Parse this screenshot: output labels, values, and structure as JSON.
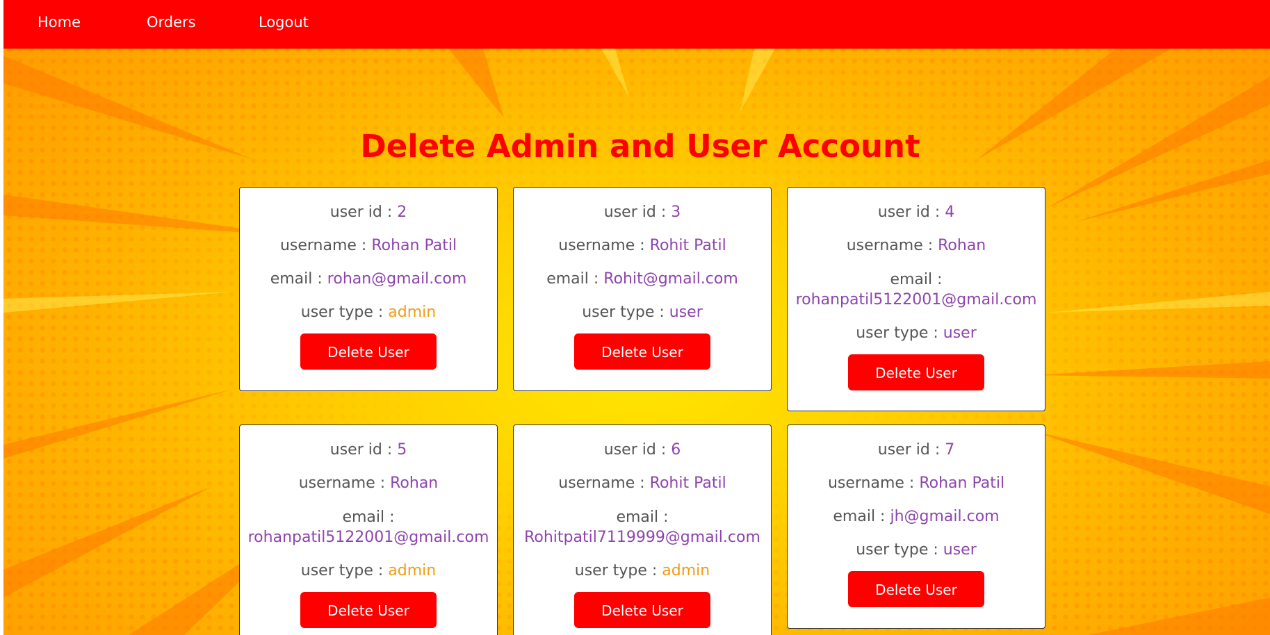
{
  "nav": {
    "home": "Home",
    "orders": "Orders",
    "logout": "Logout"
  },
  "page_title": "Delete Admin and User Account",
  "labels": {
    "user_id": "user id : ",
    "username": "username : ",
    "email": "email : ",
    "user_type": "user type : "
  },
  "delete_button_label": "Delete User",
  "colors": {
    "navbar": "#ff0000",
    "title": "#ff0000",
    "button": "#ff0000",
    "value": "#8e44ad",
    "admin_type": "#f39c12"
  },
  "users": [
    {
      "id": "2",
      "username": "Rohan Patil",
      "email": "rohan@gmail.com",
      "type": "admin"
    },
    {
      "id": "3",
      "username": "Rohit Patil",
      "email": "Rohit@gmail.com",
      "type": "user"
    },
    {
      "id": "4",
      "username": "Rohan",
      "email": "rohanpatil5122001@gmail.com",
      "type": "user"
    },
    {
      "id": "5",
      "username": "Rohan",
      "email": "rohanpatil5122001@gmail.com",
      "type": "admin"
    },
    {
      "id": "6",
      "username": "Rohit Patil",
      "email": "Rohitpatil7119999@gmail.com",
      "type": "admin"
    },
    {
      "id": "7",
      "username": "Rohan Patil",
      "email": "jh@gmail.com",
      "type": "user"
    }
  ]
}
